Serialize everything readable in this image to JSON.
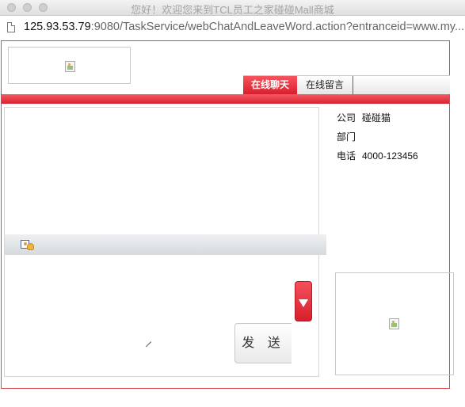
{
  "window": {
    "title": "您好！欢迎您来到TCL员工之家碰碰Mall商城",
    "url_host": "125.93.53.79",
    "url_rest": ":9080/TaskService/webChatAndLeaveWord.action?entranceid=www.my..."
  },
  "tabs": [
    {
      "label": "在线聊天",
      "active": true
    },
    {
      "label": "在线留言",
      "active": false
    }
  ],
  "send_button": {
    "label": "发 送"
  },
  "info": {
    "company_label": "公司",
    "company_value": "碰碰猫",
    "dept_label": "部门",
    "dept_value": "",
    "phone_label": "电话",
    "phone_value": "4000-123456"
  },
  "colors": {
    "accent": "#e12b38",
    "frame": "#d84a4a"
  },
  "icons": [
    "document-icon",
    "broken-image-icon",
    "emoji-icon",
    "arrow-down-icon",
    "resize-grip-icon"
  ]
}
